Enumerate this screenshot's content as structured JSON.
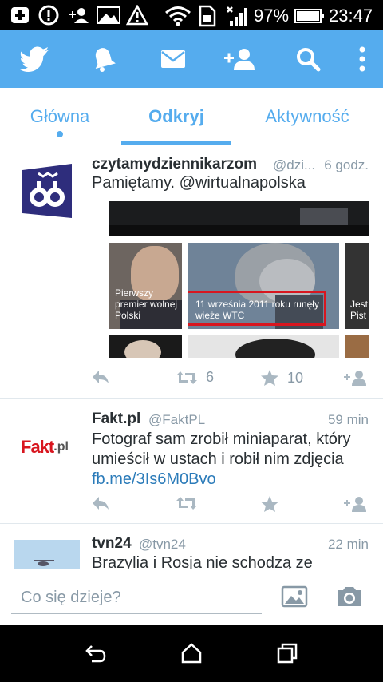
{
  "status_bar": {
    "battery_percent": "97%",
    "time": "23:47"
  },
  "action_bar": {
    "icons": [
      "twitter-bird-icon",
      "notifications-bell-icon",
      "messages-envelope-icon",
      "add-user-icon",
      "search-icon",
      "overflow-menu-icon"
    ]
  },
  "tabs": [
    {
      "label": "Główna"
    },
    {
      "label": "Odkryj"
    },
    {
      "label": "Aktywność"
    }
  ],
  "tweets": [
    {
      "name": "czytamydziennikarzom",
      "handle": "@dzi...",
      "time": "6 godz.",
      "text": "Pamiętamy. @wirtualnapolska",
      "retweets": "6",
      "favorites": "10",
      "media": {
        "caption_left": "Pierwszy premier wolnej Polski",
        "caption_center": "11 września 2011 roku runęły wieże WTC",
        "caption_right": "Jest Pist"
      }
    },
    {
      "name": "Fakt.pl",
      "handle": "@FaktPL",
      "time": "59 min",
      "text": "Fotograf sam zrobił miniaparat, który umieścił w ustach i robił nim zdjęcia",
      "link": "fb.me/3Is6M0Bvo",
      "avatar_text": "Fakt",
      "avatar_text_suffix": ".pl"
    },
    {
      "name": "tvn24",
      "handle": "@tvn24",
      "time": "22 min",
      "text": "Brazylia i Rosja nie schodzą ze"
    }
  ],
  "composer": {
    "placeholder": "Co się dzieje?"
  },
  "colors": {
    "brand_blue": "#55acee",
    "text_dark": "#292f33",
    "text_gray": "#8899a6",
    "link": "#2b7bb9",
    "highlight_red": "#d8161f"
  }
}
